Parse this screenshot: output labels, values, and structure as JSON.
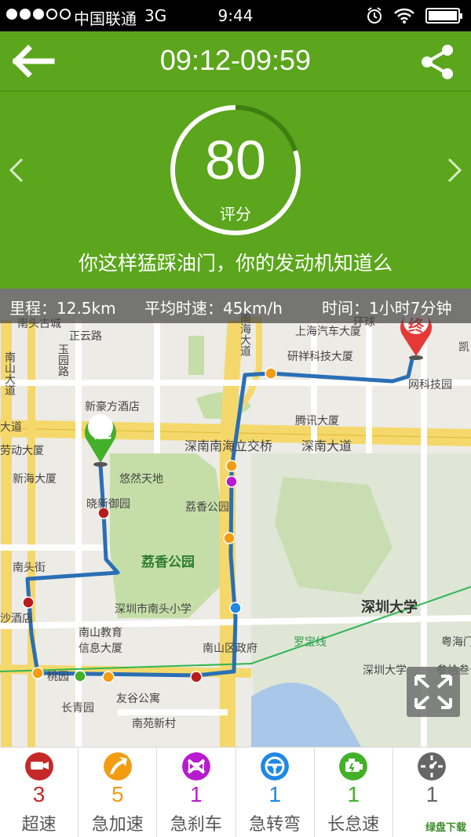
{
  "status_bar": {
    "carrier": "中国联通",
    "network": "3G",
    "time": "9:44"
  },
  "header": {
    "title": "09:12-09:59",
    "back_icon": "arrow-left-icon",
    "share_icon": "share-icon"
  },
  "score": {
    "value": "80",
    "label": "评分",
    "ring_fraction": 0.8,
    "comment": "你这样猛踩油门，你的发动机知道么"
  },
  "trip_info": {
    "distance": "里程：12.5km",
    "avg_speed": "平均时速：45km/h",
    "duration": "时间：1小时7分钟"
  },
  "map": {
    "start_marker": "起",
    "end_marker": "终",
    "labels": {
      "nantou_city": "南头古城",
      "zhengyun_road": "正云路",
      "yuyuan_road": "玉园路",
      "xinhao_fang": "新豪方酒店",
      "nanshan_dadao": "南山大道",
      "shennan_overpass": "深南南海立交桥",
      "shennan_dadao": "深南大道",
      "shennan_dadao_left": "大道",
      "laodong_building": "劳动大厦",
      "xinhai_building": "新海大厦",
      "youran_tiandi": "悠然天地",
      "xijin_garden": "晓新御园",
      "lixiang_garden": "荔香公园",
      "lixiang_park": "荔香公园",
      "nantou_street": "南头街",
      "nantou_primary": "深圳市南头小学",
      "nanshan_edu": "南山教育信息大厦",
      "nanshan_gov": "南山区政府",
      "taoyuan": "桃园",
      "youyuan_building": "友谷公寓",
      "changqing_garden": "长青园",
      "nanyuan_village": "南苑新村",
      "shaoda_hotel": "沙酒店",
      "shenzhen_univ": "深圳大学",
      "shenzhen_univ_small": "深圳大学",
      "yanxiang_building": "研祥科技大厦",
      "tengxun_building": "腾讯大厦",
      "shanghai_hotel": "上海汽车大厦",
      "huanxiao": "环球",
      "technology_park": "网科技园",
      "luobao_line": "罗宝线",
      "yuehai_gate": "粤海门",
      "canggui_road": "参拾叁号",
      "nanhai_dadao": "南海大道",
      "kai": "凯"
    }
  },
  "events": [
    {
      "label": "超速",
      "count": "3",
      "icon": "speeding-camera-icon",
      "color": "#c62828"
    },
    {
      "label": "急加速",
      "count": "5",
      "icon": "acceleration-arrow-icon",
      "color": "#f39c12"
    },
    {
      "label": "急刹车",
      "count": "1",
      "icon": "hard-brake-icon",
      "color": "#b81bcf"
    },
    {
      "label": "急转弯",
      "count": "1",
      "icon": "steering-wheel-icon",
      "color": "#1e88e5"
    },
    {
      "label": "长怠速",
      "count": "1",
      "icon": "engine-idle-icon",
      "color": "#43b02a"
    },
    {
      "label": "",
      "count": "1",
      "icon": "clock-icon",
      "color": "#666666"
    }
  ],
  "watermark": "绿盘下载",
  "colors": {
    "brand_green": "#5ba61c",
    "route_blue": "#2a6fb5"
  }
}
